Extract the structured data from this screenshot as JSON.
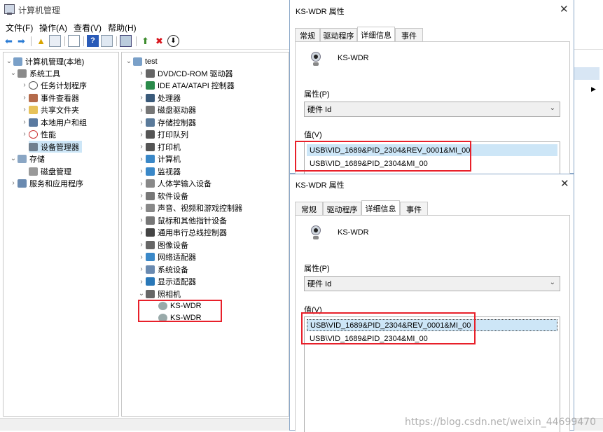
{
  "main_window": {
    "title": "计算机管理",
    "menu": [
      "文件(F)",
      "操作(A)",
      "查看(V)",
      "帮助(H)"
    ],
    "left_tree": [
      {
        "label": "计算机管理(本地)",
        "level": 0,
        "expand": "open"
      },
      {
        "label": "系统工具",
        "level": 1,
        "expand": "open"
      },
      {
        "label": "任务计划程序",
        "level": 2,
        "expand": "closed"
      },
      {
        "label": "事件查看器",
        "level": 2,
        "expand": "closed"
      },
      {
        "label": "共享文件夹",
        "level": 2,
        "expand": "closed"
      },
      {
        "label": "本地用户和组",
        "level": 2,
        "expand": "closed"
      },
      {
        "label": "性能",
        "level": 2,
        "expand": "closed"
      },
      {
        "label": "设备管理器",
        "level": 2,
        "expand": "none",
        "selected": true
      },
      {
        "label": "存储",
        "level": 1,
        "expand": "open"
      },
      {
        "label": "磁盘管理",
        "level": 2,
        "expand": "none"
      },
      {
        "label": "服务和应用程序",
        "level": 1,
        "expand": "closed"
      }
    ],
    "device_tree": {
      "root": "test",
      "categories": [
        "DVD/CD-ROM 驱动器",
        "IDE ATA/ATAPI 控制器",
        "处理器",
        "磁盘驱动器",
        "存储控制器",
        "打印队列",
        "打印机",
        "计算机",
        "监视器",
        "人体学输入设备",
        "软件设备",
        "声音、视频和游戏控制器",
        "鼠标和其他指针设备",
        "通用串行总线控制器",
        "图像设备",
        "网络适配器",
        "系统设备",
        "显示适配器",
        "照相机"
      ],
      "cameras": [
        "KS-WDR",
        "KS-WDR"
      ]
    }
  },
  "dialog1": {
    "title": "KS-WDR 属性",
    "tabs": [
      "常规",
      "驱动程序",
      "详细信息",
      "事件"
    ],
    "active_tab": "详细信息",
    "device_name": "KS-WDR",
    "property_label": "属性(P)",
    "property_value": "硬件 Id",
    "value_label": "值(V)",
    "values": [
      "USB\\VID_1689&PID_2304&REV_0001&MI_00",
      "USB\\VID_1689&PID_2304&MI_00"
    ]
  },
  "dialog2": {
    "title": "KS-WDR 属性",
    "tabs": [
      "常规",
      "驱动程序",
      "详细信息",
      "事件"
    ],
    "active_tab": "详细信息",
    "device_name": "KS-WDR",
    "property_label": "属性(P)",
    "property_value": "硬件 Id",
    "value_label": "值(V)",
    "values": [
      "USB\\VID_1689&PID_2304&REV_0001&MI_00",
      "USB\\VID_1689&PID_2304&MI_00"
    ]
  },
  "watermark": "https://blog.csdn.net/weixin_44699470",
  "colors": {
    "highlight_box": "#e8202a",
    "selection": "#cde6f7"
  }
}
